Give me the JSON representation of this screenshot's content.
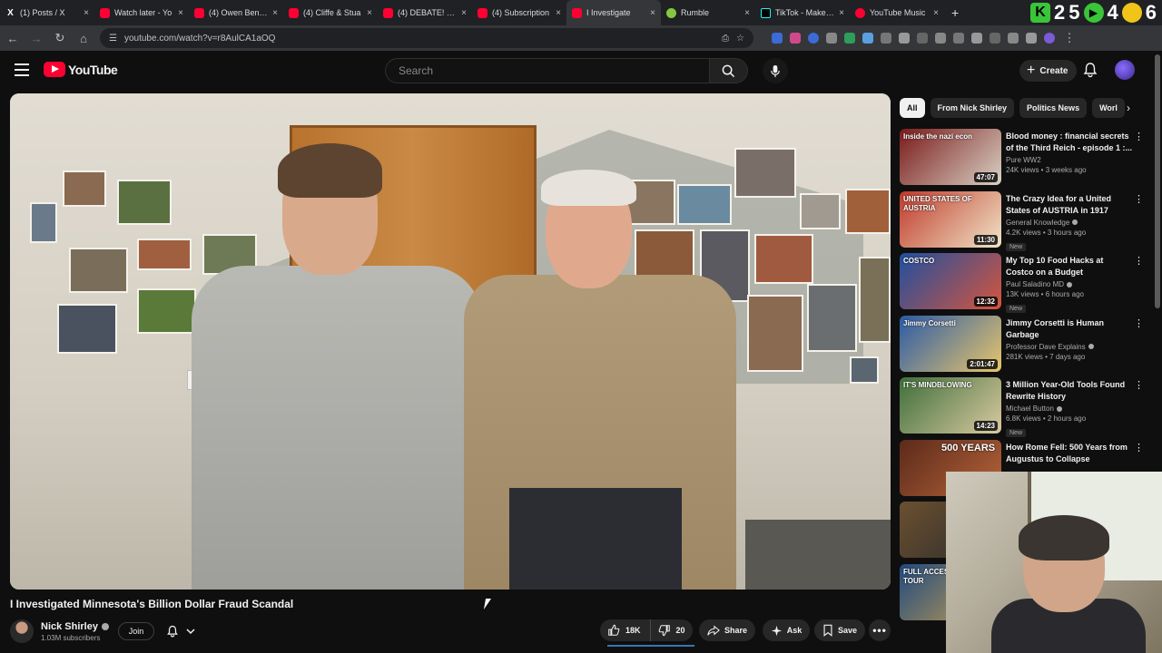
{
  "browser": {
    "tabs": [
      {
        "title": "(1) Posts / X",
        "icon": "x-icon"
      },
      {
        "title": "Watch later - Yo",
        "icon": "youtube-icon"
      },
      {
        "title": "(4) Owen Benjam",
        "icon": "youtube-icon"
      },
      {
        "title": "(4) Cliffe & Stua",
        "icon": "youtube-icon"
      },
      {
        "title": "(4) DEBATE! Whe",
        "icon": "youtube-icon"
      },
      {
        "title": "(4) Subscription",
        "icon": "youtube-icon"
      },
      {
        "title": "I Investigate",
        "icon": "youtube-icon",
        "active": true
      },
      {
        "title": "Rumble",
        "icon": "rumble-icon"
      },
      {
        "title": "TikTok - Make Yo",
        "icon": "tiktok-icon"
      },
      {
        "title": "YouTube Music",
        "icon": "youtube-music-icon"
      }
    ],
    "url": "youtube.com/watch?v=r8AulCA1aOQ",
    "overlay": {
      "k": "K",
      "n1": "2",
      "n2": "5",
      "n3": "4",
      "n4": "6"
    }
  },
  "masthead": {
    "logo_text": "YouTube",
    "search_placeholder": "Search",
    "create_label": "Create"
  },
  "video": {
    "title": "I Investigated Minnesota's Billion Dollar Fraud Scandal",
    "channel": "Nick Shirley",
    "subscribers": "1.03M subscribers",
    "join_label": "Join",
    "likes": "18K",
    "dislikes": "20",
    "share_label": "Share",
    "ask_label": "Ask",
    "save_label": "Save"
  },
  "sidebar": {
    "chips": [
      "All",
      "From Nick Shirley",
      "Politics News",
      "Worl"
    ],
    "recommendations": [
      {
        "title": "Blood money : financial secrets of the Third Reich - episode 1 :...",
        "channel": "Pure WW2",
        "verified": false,
        "stats": "24K views • 3 weeks ago",
        "duration": "47:07",
        "new": false,
        "thumb_text": "Inside the nazi econ",
        "colors": [
          "#7a1a1a",
          "#d9d2c4"
        ]
      },
      {
        "title": "The Crazy Idea for a United States of AUSTRIA in 1917",
        "channel": "General Knowledge",
        "verified": true,
        "stats": "4.2K views • 3 hours ago",
        "duration": "11:30",
        "new": true,
        "thumb_text": "UNITED STATES OF AUSTRIA",
        "colors": [
          "#c0392b",
          "#f0e6c8"
        ]
      },
      {
        "title": "My Top 10 Food Hacks at Costco on a Budget",
        "channel": "Paul Saladino MD",
        "verified": true,
        "stats": "13K views • 6 hours ago",
        "duration": "12:32",
        "new": true,
        "thumb_text": "COSTCO",
        "colors": [
          "#1f4fa0",
          "#d6553d"
        ]
      },
      {
        "title": "Jimmy Corsetti is Human Garbage",
        "channel": "Professor Dave Explains",
        "verified": true,
        "stats": "281K views • 7 days ago",
        "duration": "2:01:47",
        "new": false,
        "thumb_text": "Jimmy Corsetti",
        "colors": [
          "#2a5aa8",
          "#e8c66a"
        ]
      },
      {
        "title": "3 Million Year-Old Tools Found Rewrite History",
        "channel": "Michael Button",
        "verified": true,
        "stats": "6.8K views • 2 hours ago",
        "duration": "14:23",
        "new": true,
        "thumb_text": "IT'S MINDBLOWING",
        "colors": [
          "#3f6f3a",
          "#d9c9a0"
        ]
      },
      {
        "title": "How Rome Fell: 500 Years from Augustus to Collapse",
        "channel": "",
        "verified": false,
        "stats": "",
        "duration": "",
        "new": false,
        "thumb_text": "500 YEARS",
        "colors": [
          "#5c2a1a",
          "#b5643a"
        ]
      },
      {
        "title": "",
        "channel": "",
        "verified": false,
        "stats": "",
        "duration": "",
        "new": false,
        "thumb_text": "",
        "colors": [
          "#6b5030",
          "#2b2b2b"
        ]
      },
      {
        "title": "",
        "channel": "",
        "verified": false,
        "stats": "",
        "duration": "",
        "new": false,
        "thumb_text": "FULL ACCESS EXPERT TOUR",
        "colors": [
          "#204a80",
          "#c8a050"
        ]
      }
    ]
  },
  "colors": {
    "bg": "#0f0f0f",
    "brand_red": "#ff0033",
    "chip_bg": "#272727"
  }
}
